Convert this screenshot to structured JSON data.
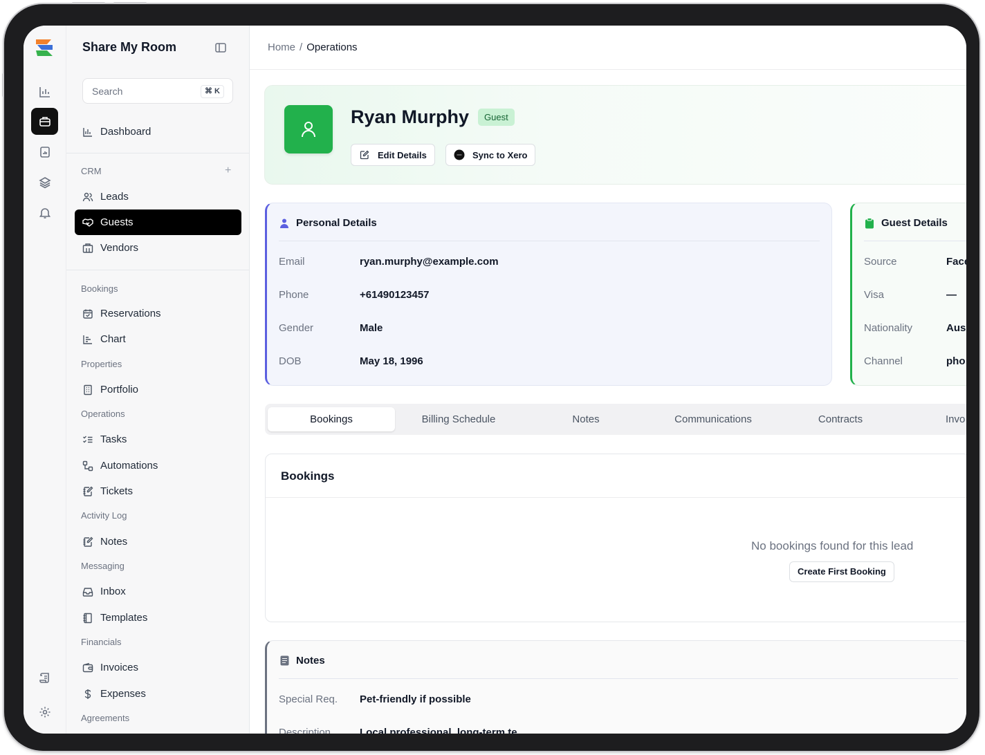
{
  "app": {
    "name": "Share My Room"
  },
  "search": {
    "placeholder": "Search",
    "shortcut": "⌘ K"
  },
  "sidebar": {
    "dashboard": "Dashboard",
    "crm": {
      "title": "CRM",
      "items": [
        "Leads",
        "Guests",
        "Vendors"
      ]
    },
    "bookings": {
      "title": "Bookings",
      "items": [
        "Reservations",
        "Chart"
      ]
    },
    "properties": {
      "title": "Properties",
      "items": [
        "Portfolio"
      ]
    },
    "operations": {
      "title": "Operations",
      "items": [
        "Tasks",
        "Automations",
        "Tickets"
      ]
    },
    "activity": {
      "title": "Activity Log",
      "items": [
        "Notes"
      ]
    },
    "messaging": {
      "title": "Messaging",
      "items": [
        "Inbox",
        "Templates"
      ]
    },
    "financials": {
      "title": "Financials",
      "items": [
        "Invoices",
        "Expenses"
      ]
    },
    "agreements": {
      "title": "Agreements"
    }
  },
  "breadcrumb": {
    "home": "Home",
    "separator": "/",
    "current": "Operations"
  },
  "guest": {
    "name": "Ryan Murphy",
    "badge": "Guest",
    "edit_label": "Edit Details",
    "sync_label": "Sync to Xero"
  },
  "personal": {
    "title": "Personal Details",
    "rows": [
      {
        "label": "Email",
        "value": "ryan.murphy@example.com"
      },
      {
        "label": "Phone",
        "value": "+61490123457"
      },
      {
        "label": "Gender",
        "value": "Male"
      },
      {
        "label": "DOB",
        "value": "May 18, 1996"
      }
    ]
  },
  "guest_details": {
    "title": "Guest Details",
    "rows": [
      {
        "label": "Source",
        "value": "Face"
      },
      {
        "label": "Visa",
        "value": "—"
      },
      {
        "label": "Nationality",
        "value": "Aus"
      },
      {
        "label": "Channel",
        "value": "pho"
      }
    ]
  },
  "tabs": [
    "Bookings",
    "Billing Schedule",
    "Notes",
    "Communications",
    "Contracts",
    "Invo"
  ],
  "bookings_panel": {
    "title": "Bookings",
    "empty_message": "No bookings found for this lead",
    "create_label": "Create First Booking"
  },
  "notes_panel": {
    "title": "Notes",
    "rows": [
      {
        "label": "Special Req.",
        "value": "Pet-friendly if possible"
      },
      {
        "label": "Description",
        "value": "Local professional, long-term te"
      }
    ]
  },
  "colors": {
    "accent_green": "#22b14c",
    "accent_indigo": "#5b5fe0",
    "active_nav": "#000000"
  },
  "icons": {
    "rail": [
      "bar-chart-icon",
      "briefcase-icon",
      "report-icon",
      "layers-icon",
      "bell-icon",
      "scroll-icon",
      "gear-icon"
    ]
  }
}
